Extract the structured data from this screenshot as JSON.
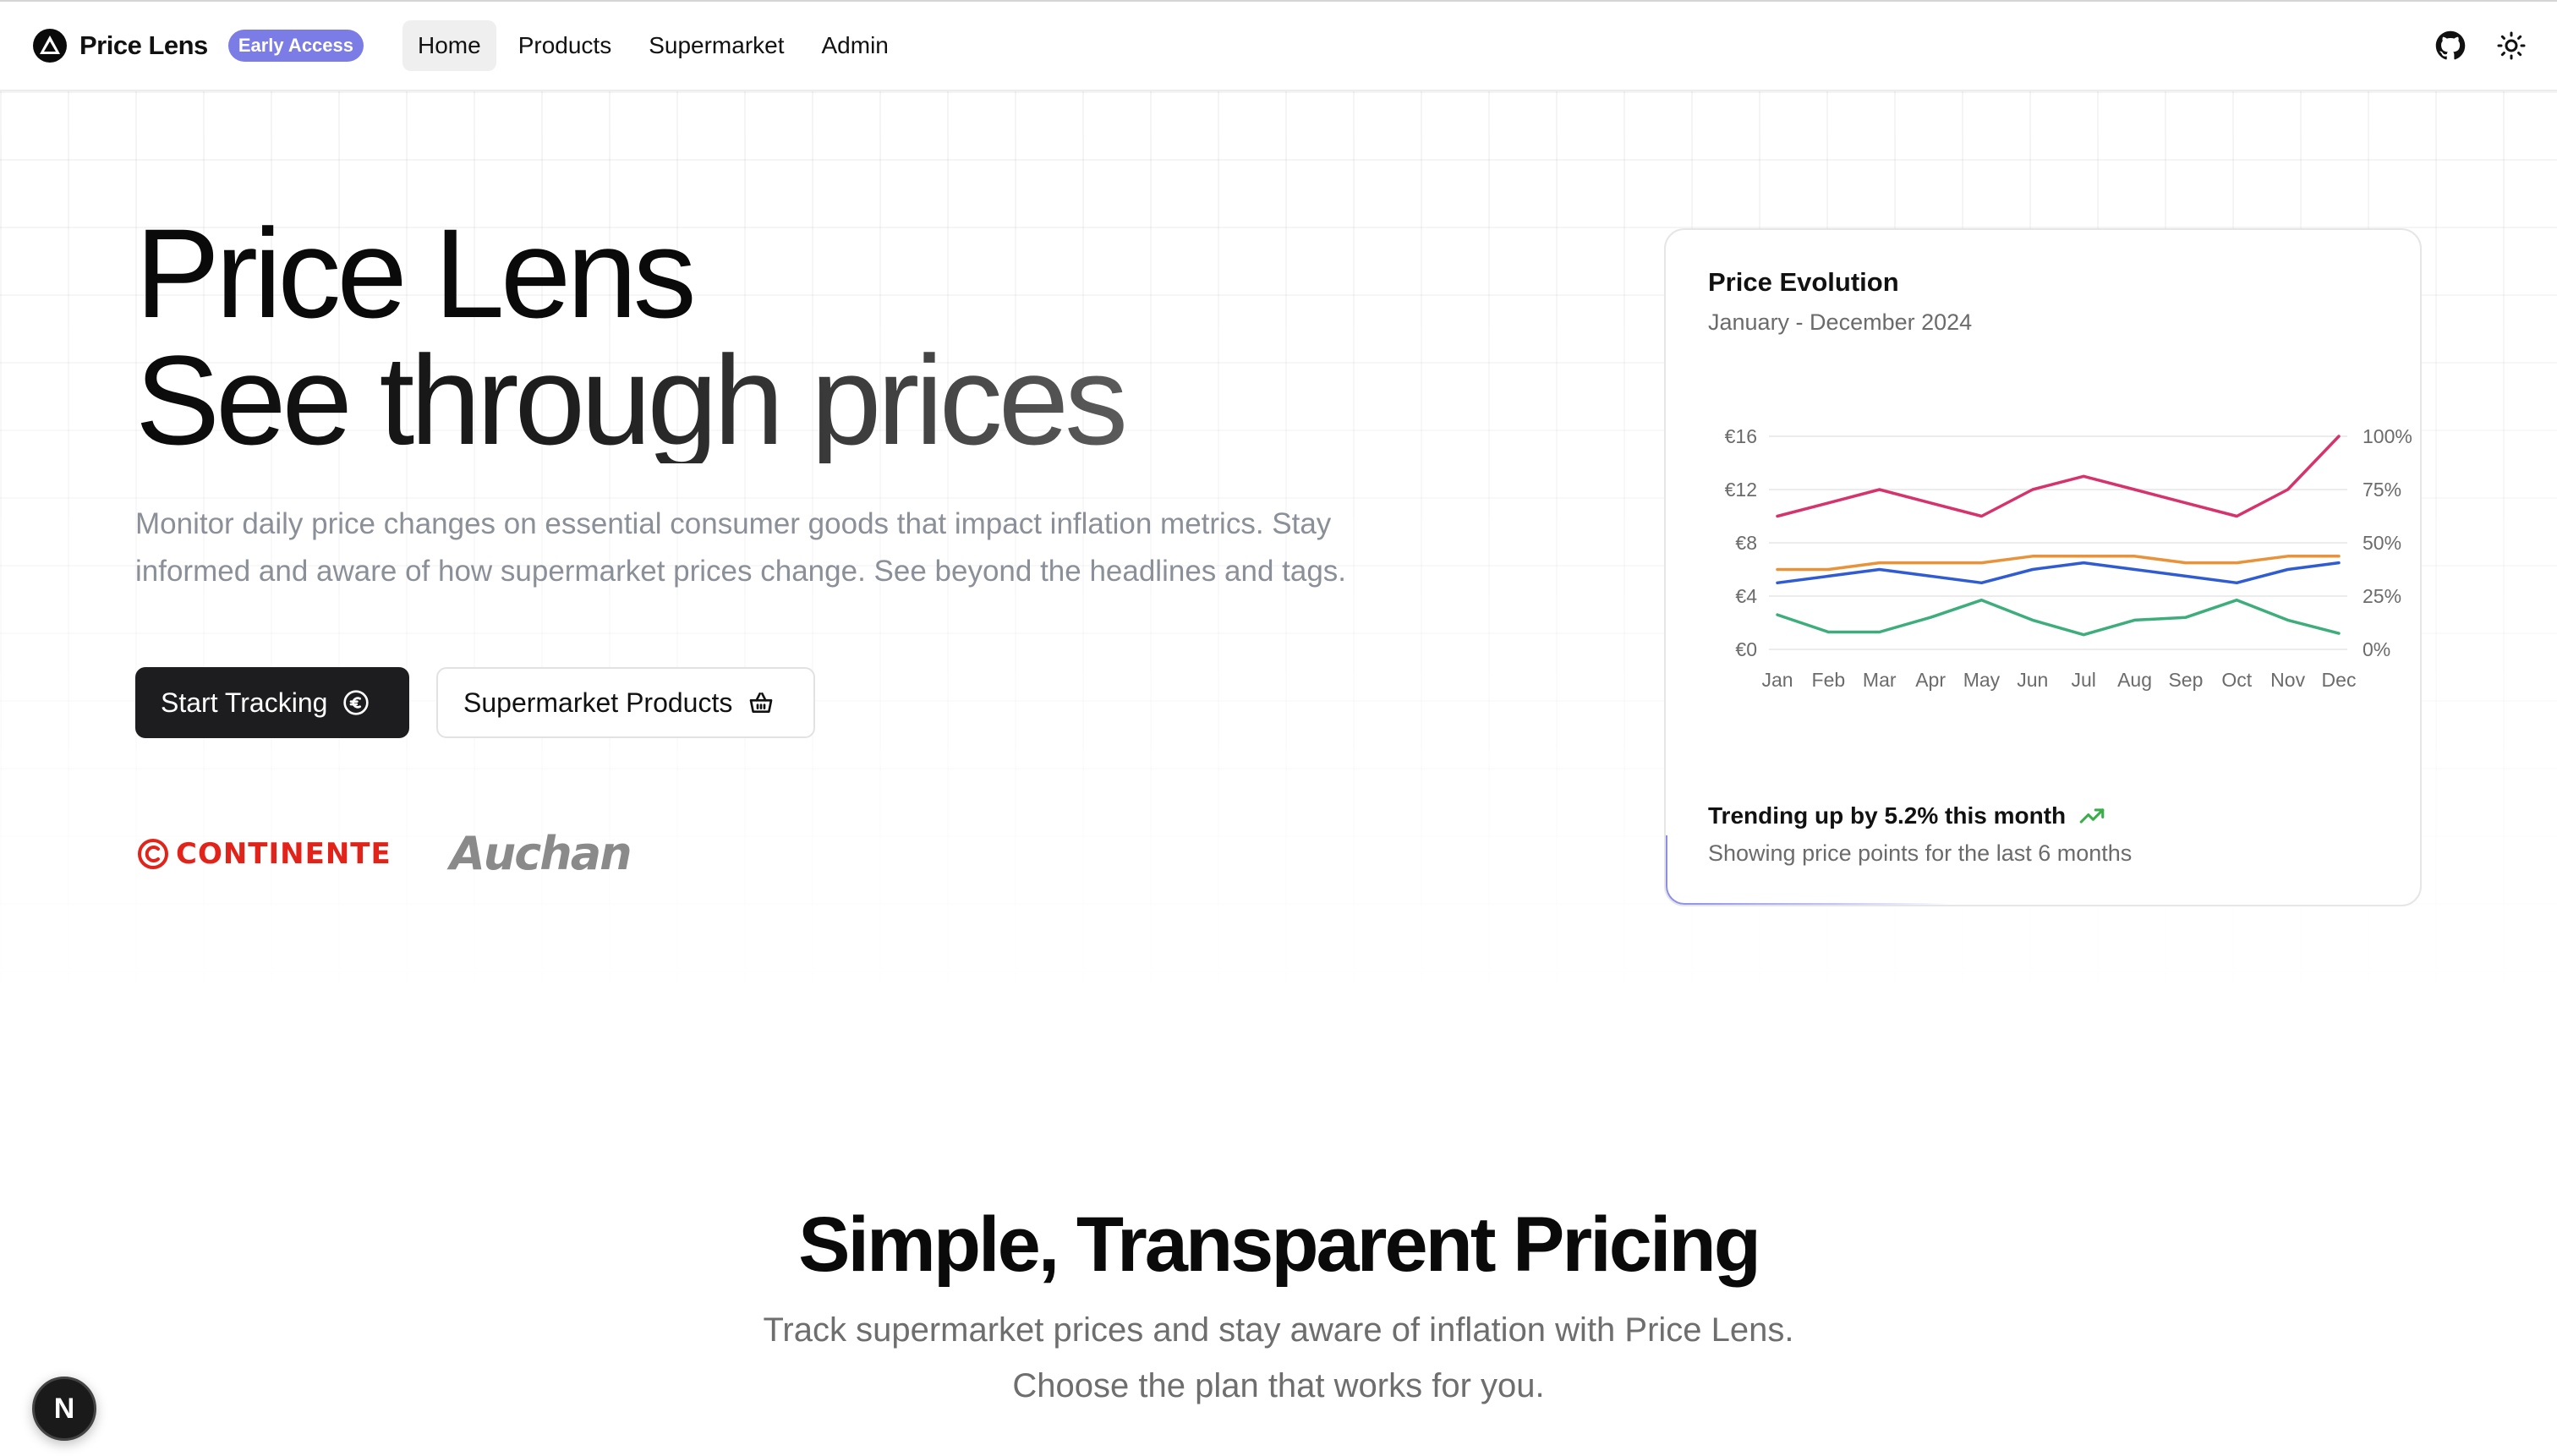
{
  "nav": {
    "brand": "Price Lens",
    "badge": "Early Access",
    "links": [
      {
        "label": "Home",
        "active": true
      },
      {
        "label": "Products",
        "active": false
      },
      {
        "label": "Supermarket",
        "active": false
      },
      {
        "label": "Admin",
        "active": false
      }
    ],
    "icons": [
      "github-icon",
      "sun-icon"
    ]
  },
  "hero": {
    "title_line1": "Price Lens",
    "title_line2": "See through prices",
    "description": "Monitor daily price changes on essential consumer goods that impact inflation metrics. Stay informed and aware of how supermarket prices change. See beyond the headlines and tags.",
    "primary_button": "Start Tracking",
    "secondary_button": "Supermarket Products",
    "logos": [
      {
        "text": "CONTINENTE",
        "color": "#e2231a"
      },
      {
        "text": "Auchan",
        "color": "#8a8a8a"
      }
    ]
  },
  "chart_card": {
    "title": "Price Evolution",
    "subtitle": "January - December 2024",
    "trend": "Trending up by 5.2% this month",
    "footer": "Showing price points for the last 6 months"
  },
  "chart_data": {
    "type": "line",
    "categories": [
      "Jan",
      "Feb",
      "Mar",
      "Apr",
      "May",
      "Jun",
      "Jul",
      "Aug",
      "Sep",
      "Oct",
      "Nov",
      "Dec"
    ],
    "y_left": {
      "ticks": [
        "€16",
        "€12",
        "€8",
        "€4",
        "€0"
      ],
      "range": [
        0,
        16
      ]
    },
    "y_right": {
      "ticks": [
        "100%",
        "75%",
        "50%",
        "25%",
        "0%"
      ],
      "range": [
        0,
        100
      ]
    },
    "series": [
      {
        "color": "#d6336c",
        "values": [
          10,
          11,
          12,
          11,
          10,
          12,
          13,
          12,
          11,
          10,
          12,
          16
        ]
      },
      {
        "color": "#e8923a",
        "values": [
          6,
          6,
          6.5,
          6.5,
          6.5,
          7,
          7,
          7,
          6.5,
          6.5,
          7,
          7
        ]
      },
      {
        "color": "#2f5bd3",
        "values": [
          5,
          5.5,
          6,
          5.5,
          5,
          6,
          6.5,
          6,
          5.5,
          5,
          6,
          6.5
        ]
      },
      {
        "color": "#3dad7c",
        "values": [
          2.6,
          1.3,
          1.3,
          2.4,
          3.7,
          2.2,
          1.1,
          2.2,
          2.4,
          3.7,
          2.2,
          1.2
        ]
      }
    ],
    "grid": true,
    "legend": "none"
  },
  "pricing": {
    "title": "Simple, Transparent Pricing",
    "subtitle_line1": "Track supermarket prices and stay aware of inflation with Price Lens.",
    "subtitle_line2": "Choose the plan that works for you."
  },
  "dev_badge": "N",
  "colors": {
    "badge": "#7c7ce6",
    "primary_button": "#1d1d1f",
    "accent": "#8c8ce8",
    "trend_up": "#3dad4c"
  }
}
